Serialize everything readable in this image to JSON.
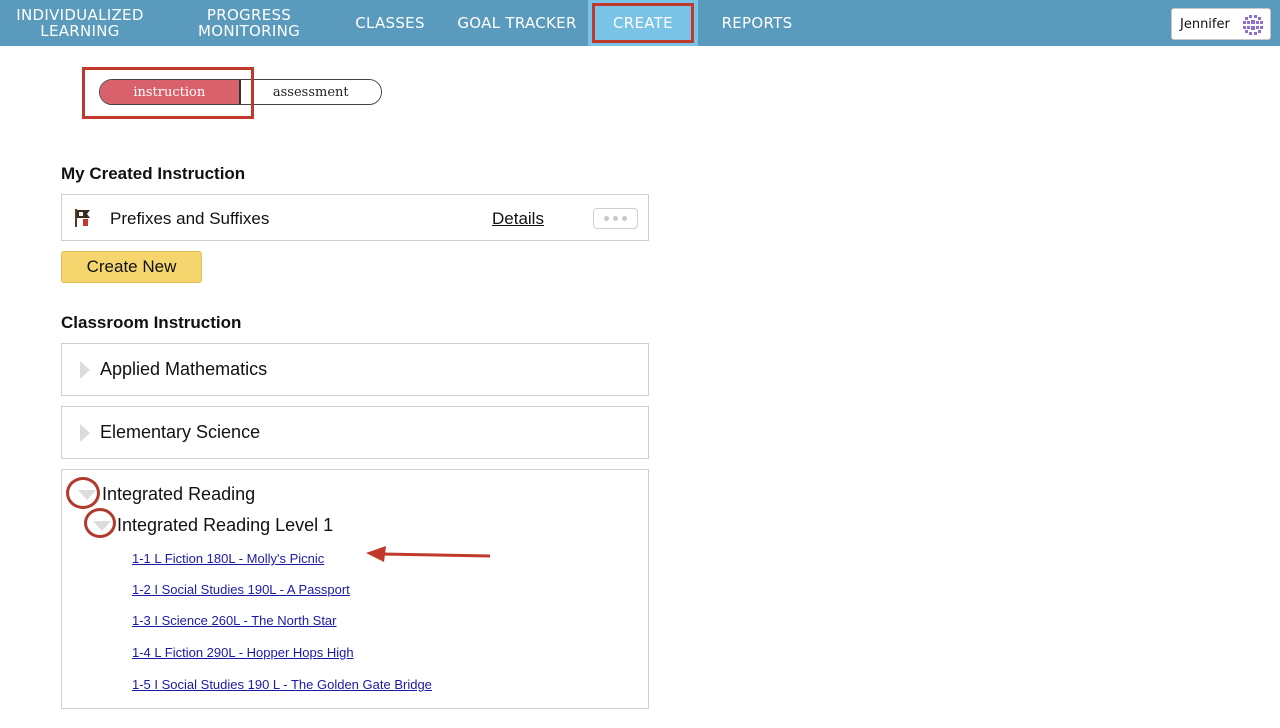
{
  "nav": {
    "items": [
      {
        "line1": "INDIVIDUALIZED",
        "line2": "LEARNING"
      },
      {
        "line1": "PROGRESS",
        "line2": "MONITORING"
      },
      {
        "line1": "CLASSES",
        "line2": ""
      },
      {
        "line1": "GOAL TRACKER",
        "line2": ""
      },
      {
        "line1": "CREATE",
        "line2": ""
      },
      {
        "line1": "REPORTS",
        "line2": ""
      }
    ],
    "active_item": "CREATE",
    "user_name": "Jennifer"
  },
  "mode_toggle": {
    "instruction_label": "instruction",
    "assessment_label": "assessment",
    "selected": "instruction"
  },
  "my_created": {
    "heading": "My Created Instruction",
    "item_title": "Prefixes and Suffixes",
    "details_label": "Details",
    "create_new_label": "Create New"
  },
  "classroom": {
    "heading": "Classroom Instruction",
    "classes": [
      "Applied Mathematics",
      "Elementary Science"
    ],
    "expanded_class": "Integrated Reading",
    "expanded_level": "Integrated Reading Level 1",
    "lessons": [
      "1-1 L Fiction 180L - Molly's Picnic",
      "1-2 I Social Studies 190L - A Passport",
      "1-3 I Science 260L - The North Star",
      "1-4 L Fiction 290L - Hopper Hops High",
      "1-5 I Social Studies 190 L - The Golden Gate Bridge"
    ]
  },
  "colors": {
    "topbar": "#5a9bbd",
    "active_tab": "#79c3e6",
    "toggle_selected": "#d9616c",
    "create_button": "#f5d66e",
    "link": "#1a1aa6",
    "annotation": "#c0392b"
  }
}
